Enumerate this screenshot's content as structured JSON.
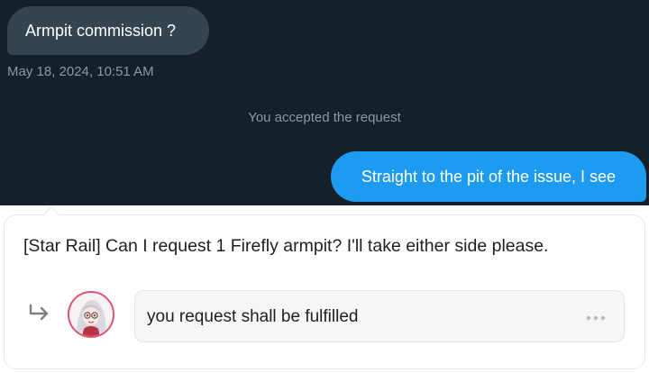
{
  "conversation": {
    "incoming_message": "Armpit commission ?",
    "timestamp": "May 18, 2024, 10:51 AM",
    "system_note": "You accepted the request",
    "outgoing_message": "Straight to the pit of the issue, I see"
  },
  "request_card": {
    "request_text": "[Star Rail] Can I request 1 Firefly armpit? I'll take either side please.",
    "reply": {
      "icon": "reply-arrow-icon",
      "avatar": "avatar",
      "text": "you request shall be fulfilled",
      "more_icon": "more-options-icon"
    }
  },
  "colors": {
    "dm_background": "#15202b",
    "incoming_bubble": "#344451",
    "outgoing_bubble": "#1d9bf0",
    "muted_text": "#8b98a5",
    "avatar_ring": "#e0526b"
  }
}
